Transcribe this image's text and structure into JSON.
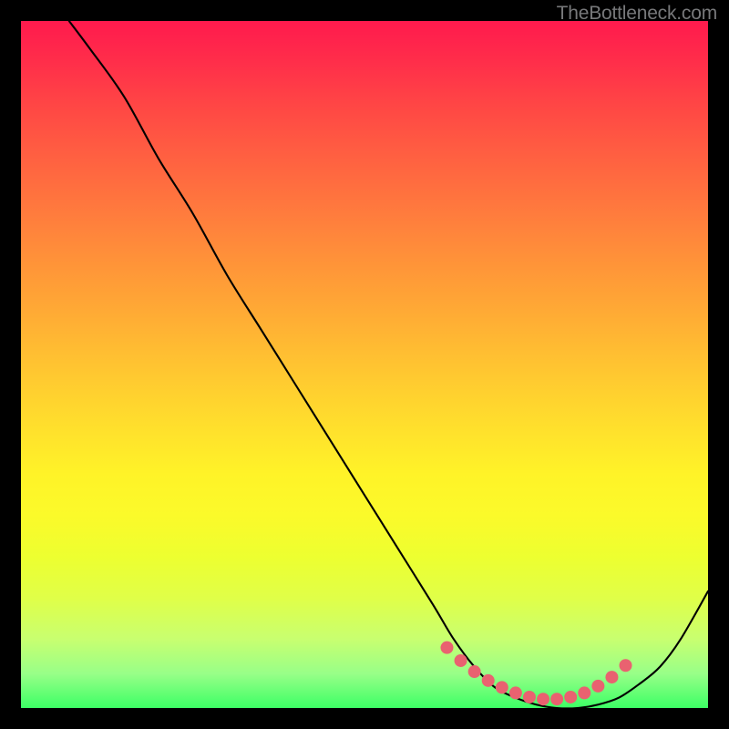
{
  "watermark": "TheBottleneck.com",
  "chart_data": {
    "type": "line",
    "title": "",
    "xlabel": "",
    "ylabel": "",
    "x_range": [
      0,
      100
    ],
    "y_range": [
      0,
      100
    ],
    "series": [
      {
        "name": "bottleneck-curve",
        "x": [
          7,
          10,
          15,
          20,
          25,
          30,
          35,
          40,
          45,
          50,
          55,
          60,
          63,
          66,
          69,
          72,
          75,
          78,
          81,
          84,
          87,
          90,
          93,
          96,
          100
        ],
        "y": [
          100,
          96,
          89,
          80,
          72,
          63,
          55,
          47,
          39,
          31,
          23,
          15,
          10,
          6,
          3,
          1.5,
          0.5,
          0,
          0,
          0.5,
          1.5,
          3.5,
          6,
          10,
          17
        ]
      }
    ],
    "markers": {
      "name": "optimal-range-markers",
      "x": [
        62,
        64,
        66,
        68,
        70,
        72,
        74,
        76,
        78,
        80,
        82,
        84,
        86,
        88
      ],
      "y": [
        8.8,
        6.9,
        5.3,
        4.0,
        3.0,
        2.2,
        1.6,
        1.3,
        1.3,
        1.6,
        2.2,
        3.2,
        4.5,
        6.2
      ],
      "color": "#e96270",
      "size": 7
    },
    "gradient": {
      "direction": "vertical",
      "stops": [
        {
          "pos": 0,
          "color": "#ff1a4d"
        },
        {
          "pos": 50,
          "color": "#ffbd32"
        },
        {
          "pos": 80,
          "color": "#edff30"
        },
        {
          "pos": 100,
          "color": "#3cff65"
        }
      ]
    }
  }
}
